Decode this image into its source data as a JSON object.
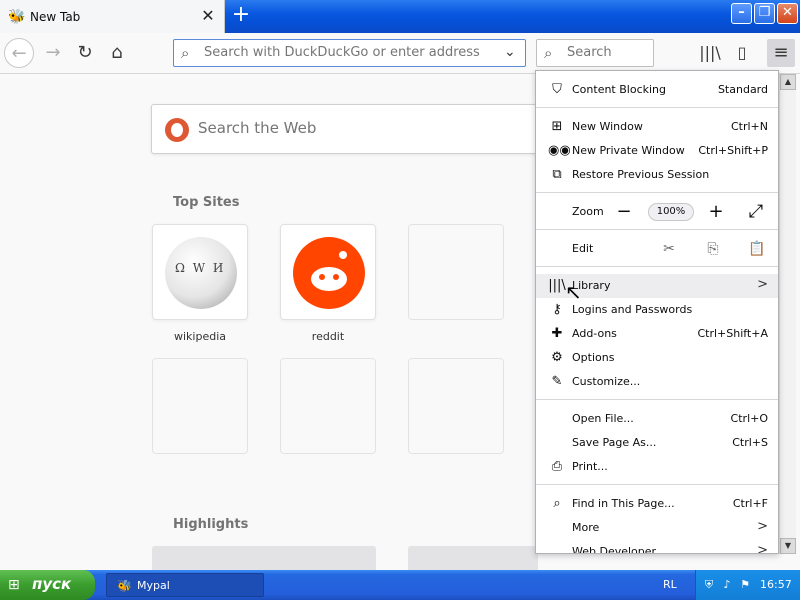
{
  "tab": {
    "title": "New Tab",
    "close_glyph": "✕",
    "favicon": "mypal-favicon-icon"
  },
  "newtab_glyph": "+",
  "window_buttons": {
    "minimize": "–",
    "restore": "❐",
    "close": "✕"
  },
  "nav": {
    "back_glyph": "←",
    "forward_glyph": "→",
    "reload_glyph": "↻",
    "home_glyph": "⌂",
    "url_placeholder": "Search with DuckDuckGo or enter address",
    "url_dropdown_glyph": "⌄",
    "search_placeholder": "Search",
    "library_glyph": "|||\\",
    "sidebar_glyph": "▯",
    "menu_glyph": "≡"
  },
  "content": {
    "search_web_placeholder": "Search the Web",
    "top_sites_title": "Top Sites",
    "highlights_title": "Highlights",
    "sites": [
      {
        "label": "wikipedia"
      },
      {
        "label": "reddit"
      }
    ]
  },
  "menu": {
    "content_blocking": {
      "label": "Content Blocking",
      "value": "Standard"
    },
    "new_window": {
      "label": "New Window",
      "shortcut": "Ctrl+N"
    },
    "new_private_window": {
      "label": "New Private Window",
      "shortcut": "Ctrl+Shift+P"
    },
    "restore_session": {
      "label": "Restore Previous Session"
    },
    "zoom": {
      "label": "Zoom",
      "minus": "−",
      "value": "100%",
      "plus": "+",
      "fullscreen": "⤢"
    },
    "edit": {
      "label": "Edit"
    },
    "library": {
      "label": "Library",
      "arrow": ">"
    },
    "logins": {
      "label": "Logins and Passwords"
    },
    "addons": {
      "label": "Add-ons",
      "shortcut": "Ctrl+Shift+A"
    },
    "options": {
      "label": "Options"
    },
    "customize": {
      "label": "Customize..."
    },
    "open_file": {
      "label": "Open File...",
      "shortcut": "Ctrl+O"
    },
    "save_page": {
      "label": "Save Page As...",
      "shortcut": "Ctrl+S"
    },
    "print": {
      "label": "Print..."
    },
    "find": {
      "label": "Find in This Page...",
      "shortcut": "Ctrl+F"
    },
    "more": {
      "label": "More",
      "arrow": ">"
    },
    "web_developer": {
      "label": "Web Developer",
      "arrow": ">"
    }
  },
  "taskbar": {
    "start_label": "пуск",
    "task_label": "Mypal",
    "language": "RL",
    "clock": "16:57"
  },
  "colors": {
    "titlebar": "#0a58e0",
    "taskbar": "#245edb",
    "start_green": "#3c9d2f",
    "ddg_orange": "#de5833",
    "reddit_orange": "#ff4500"
  }
}
